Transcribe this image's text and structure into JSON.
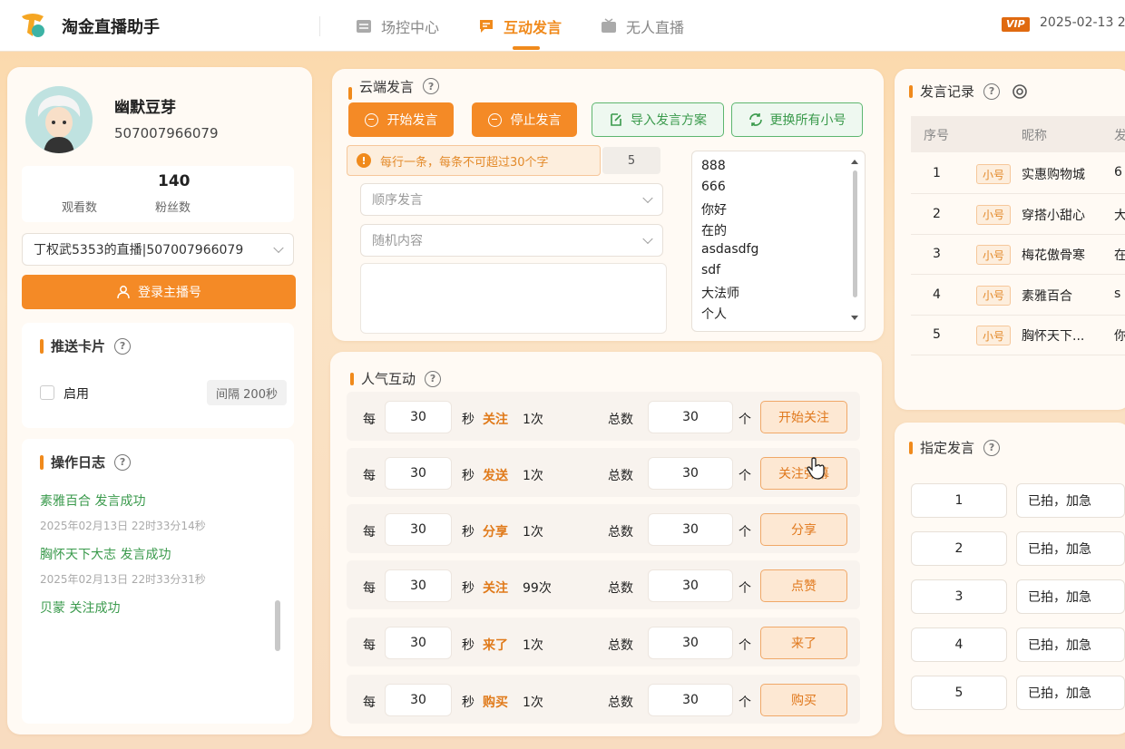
{
  "app": {
    "title": "淘金直播助手",
    "vip": "VIP",
    "date": "2025-02-13 2"
  },
  "nav": {
    "tabs": [
      {
        "label": "场控中心"
      },
      {
        "label": "互动发言"
      },
      {
        "label": "无人直播"
      }
    ],
    "active": 1
  },
  "profile": {
    "name": "幽默豆芽",
    "id": "507007966079",
    "fans_count": "140",
    "watch_label": "观看数",
    "fans_label": "粉丝数"
  },
  "live_select": {
    "value": "丁权武5353的直播|507007966079"
  },
  "login_button": "登录主播号",
  "push_card": {
    "title": "推送卡片",
    "enable_label": "启用",
    "interval": "间隔 200秒"
  },
  "log": {
    "title": "操作日志",
    "entries": [
      {
        "text": "素雅百合  发言成功",
        "time": "2025年02月13日  22时33分14秒"
      },
      {
        "text": "胸怀天下大志  发言成功",
        "time": "2025年02月13日  22时33分31秒"
      },
      {
        "text": "贝蒙  关注成功",
        "time": ""
      }
    ]
  },
  "cloud": {
    "title": "云端发言",
    "start_btn": "开始发言",
    "stop_btn": "停止发言",
    "import_btn": "导入发言方案",
    "switch_btn": "更换所有小号",
    "tip": "每行一条，每条不可超过30个字",
    "tip_num": "5",
    "order_select": "顺序发言",
    "random_select": "随机内容",
    "messages": [
      "888",
      "666",
      "你好",
      "在的",
      "asdasdfg",
      "sdf",
      "大法师",
      "个人"
    ]
  },
  "popularity": {
    "title": "人气互动",
    "every_label": "每",
    "sec_label": "秒",
    "total_label": "总数",
    "unit_label": "个",
    "rows": [
      {
        "interval": "30",
        "action": "关注",
        "times": "1次",
        "total": "30",
        "button": "开始关注"
      },
      {
        "interval": "30",
        "action": "发送",
        "times": "1次",
        "total": "30",
        "button": "关注弹幕"
      },
      {
        "interval": "30",
        "action": "分享",
        "times": "1次",
        "total": "30",
        "button": "分享"
      },
      {
        "interval": "30",
        "action": "关注",
        "times": "99次",
        "total": "30",
        "button": "点赞"
      },
      {
        "interval": "30",
        "action": "来了",
        "times": "1次",
        "total": "30",
        "button": "来了"
      },
      {
        "interval": "30",
        "action": "购买",
        "times": "1次",
        "total": "30",
        "button": "购买"
      }
    ]
  },
  "records": {
    "title": "发言记录",
    "headers": [
      "序号",
      "昵称",
      "发"
    ],
    "rows": [
      {
        "no": "1",
        "tag": "小号",
        "nick": "实惠购物城",
        "content": "6"
      },
      {
        "no": "2",
        "tag": "小号",
        "nick": "穿搭小甜心",
        "content": "大"
      },
      {
        "no": "3",
        "tag": "小号",
        "nick": "梅花傲骨寒",
        "content": "在"
      },
      {
        "no": "4",
        "tag": "小号",
        "nick": "素雅百合",
        "content": "s"
      },
      {
        "no": "5",
        "tag": "小号",
        "nick": "胸怀天下...",
        "content": "你"
      }
    ]
  },
  "designated": {
    "title": "指定发言",
    "rows": [
      {
        "no": "1",
        "text": "已拍，加急"
      },
      {
        "no": "2",
        "text": "已拍，加急"
      },
      {
        "no": "3",
        "text": "已拍，加急"
      },
      {
        "no": "4",
        "text": "已拍，加急"
      },
      {
        "no": "5",
        "text": "已拍，加急"
      }
    ]
  },
  "colors": {
    "accent": "#f08a1c",
    "green": "#3a9a4c"
  }
}
